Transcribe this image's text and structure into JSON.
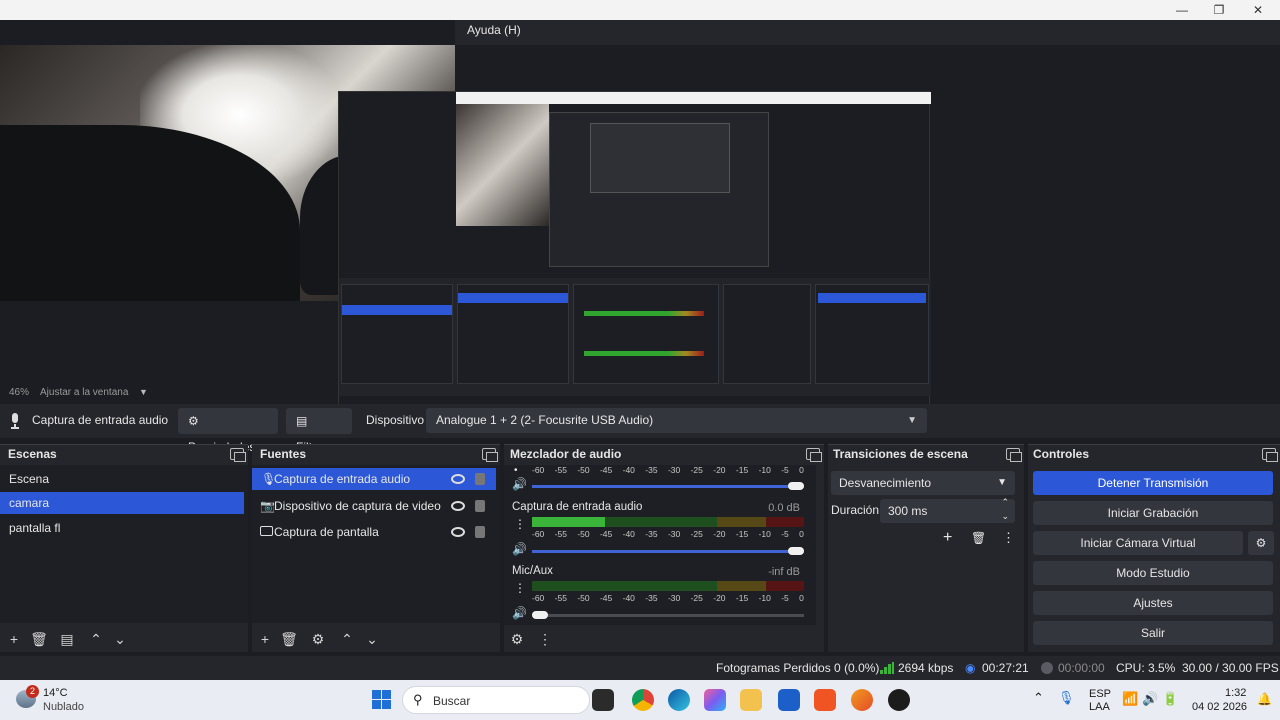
{
  "window": {
    "menu_help": "Ayuda (H)",
    "min_icon": "—",
    "max_icon": "❐",
    "close_icon": "✕"
  },
  "preview": {
    "zoom": "46%",
    "fit_label": "Ajustar a la ventana"
  },
  "source_toolbar": {
    "source_name": "Captura de entrada audio",
    "properties": "Propiedades",
    "filters": "Filtros",
    "device_label": "Dispositivo",
    "device_value": "Analogue 1 + 2 (2- Focusrite USB Audio)"
  },
  "scenes": {
    "title": "Escenas",
    "items": [
      "Escena",
      "camara",
      "pantalla fl"
    ],
    "selected": 1
  },
  "sources": {
    "title": "Fuentes",
    "items": [
      "Captura de entrada audio",
      "Dispositivo de captura de video",
      "Captura de pantalla"
    ],
    "selected": 0
  },
  "mixer": {
    "title": "Mezclador de audio",
    "ticks": [
      "-60",
      "-55",
      "-50",
      "-45",
      "-40",
      "-35",
      "-30",
      "-25",
      "-20",
      "-15",
      "-10",
      "-5",
      "0"
    ],
    "channels": [
      {
        "name": "",
        "db": "",
        "level": 0.0,
        "volume": 1.0
      },
      {
        "name": "Captura de entrada audio",
        "db": "0.0 dB",
        "level": 0.27,
        "volume": 1.0
      },
      {
        "name": "Mic/Aux",
        "db": "-inf dB",
        "level": 0.0,
        "volume": 0.0
      }
    ]
  },
  "transitions": {
    "title": "Transiciones de escena",
    "type": "Desvanecimiento",
    "duration_label": "Duración",
    "duration_value": "300 ms"
  },
  "controls": {
    "title": "Controles",
    "buttons": [
      "Detener Transmisión",
      "Iniciar Grabación",
      "Iniciar Cámara Virtual",
      "Modo Estudio",
      "Ajustes",
      "Salir"
    ]
  },
  "status": {
    "dropped": "Fotogramas Perdidos 0 (0.0%)",
    "bitrate": "2694 kbps",
    "stream_time": "00:27:21",
    "rec_time": "00:00:00",
    "cpu": "CPU: 3.5%",
    "fps": "30.00 / 30.00 FPS"
  },
  "taskbar": {
    "weather_temp": "14°C",
    "weather_desc": "Nublado",
    "weather_badge": "2",
    "search": "Buscar",
    "lang1": "ESP",
    "lang2": "LAA",
    "time": "1:32",
    "date": "04 02 2026"
  },
  "colors": {
    "accent": "#2c58d8",
    "panel": "#25262b",
    "meter_green": "#3ab53a"
  }
}
